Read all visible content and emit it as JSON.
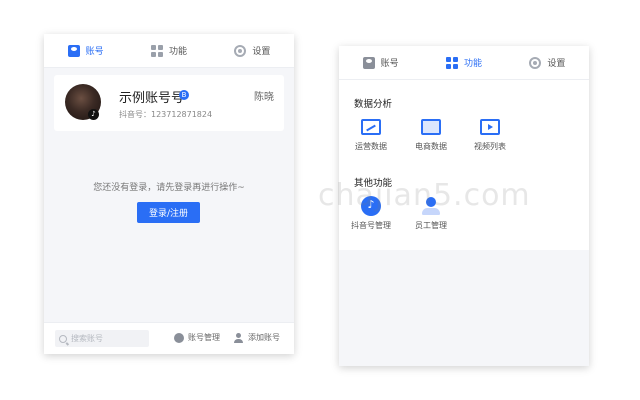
{
  "left_panel": {
    "tabs": [
      {
        "label": "账号",
        "icon": "user-icon",
        "active": true
      },
      {
        "label": "功能",
        "icon": "grid-icon",
        "active": false
      },
      {
        "label": "设置",
        "icon": "gear-icon",
        "active": false
      }
    ],
    "account_card": {
      "name": "示例账号号",
      "verified_badge": "B",
      "douyin_id": "抖音号：123712871824",
      "nickname": "陈晓"
    },
    "login_message": "您还没有登录，请先登录再进行操作~",
    "login_button": "登录/注册",
    "footer": {
      "search_placeholder": "搜索账号",
      "manage_label": "账号管理",
      "add_label": "添加账号"
    }
  },
  "right_panel": {
    "tabs": [
      {
        "label": "账号",
        "icon": "user-icon",
        "active": false
      },
      {
        "label": "功能",
        "icon": "grid-icon",
        "active": true
      },
      {
        "label": "设置",
        "icon": "gear-icon",
        "active": false
      }
    ],
    "sections": [
      {
        "title": "数据分析",
        "items": [
          {
            "label": "运营数据",
            "icon": "line-chart-icon"
          },
          {
            "label": "电商数据",
            "icon": "shop-data-icon"
          },
          {
            "label": "视频列表",
            "icon": "video-list-icon"
          }
        ]
      },
      {
        "title": "其他功能",
        "items": [
          {
            "label": "抖音号管理",
            "icon": "tiktok-icon"
          },
          {
            "label": "员工管理",
            "icon": "staff-icon"
          }
        ]
      }
    ]
  },
  "watermark": "chajian5.com",
  "colors": {
    "accent": "#2a6ef5",
    "background": "#f5f6f9"
  }
}
